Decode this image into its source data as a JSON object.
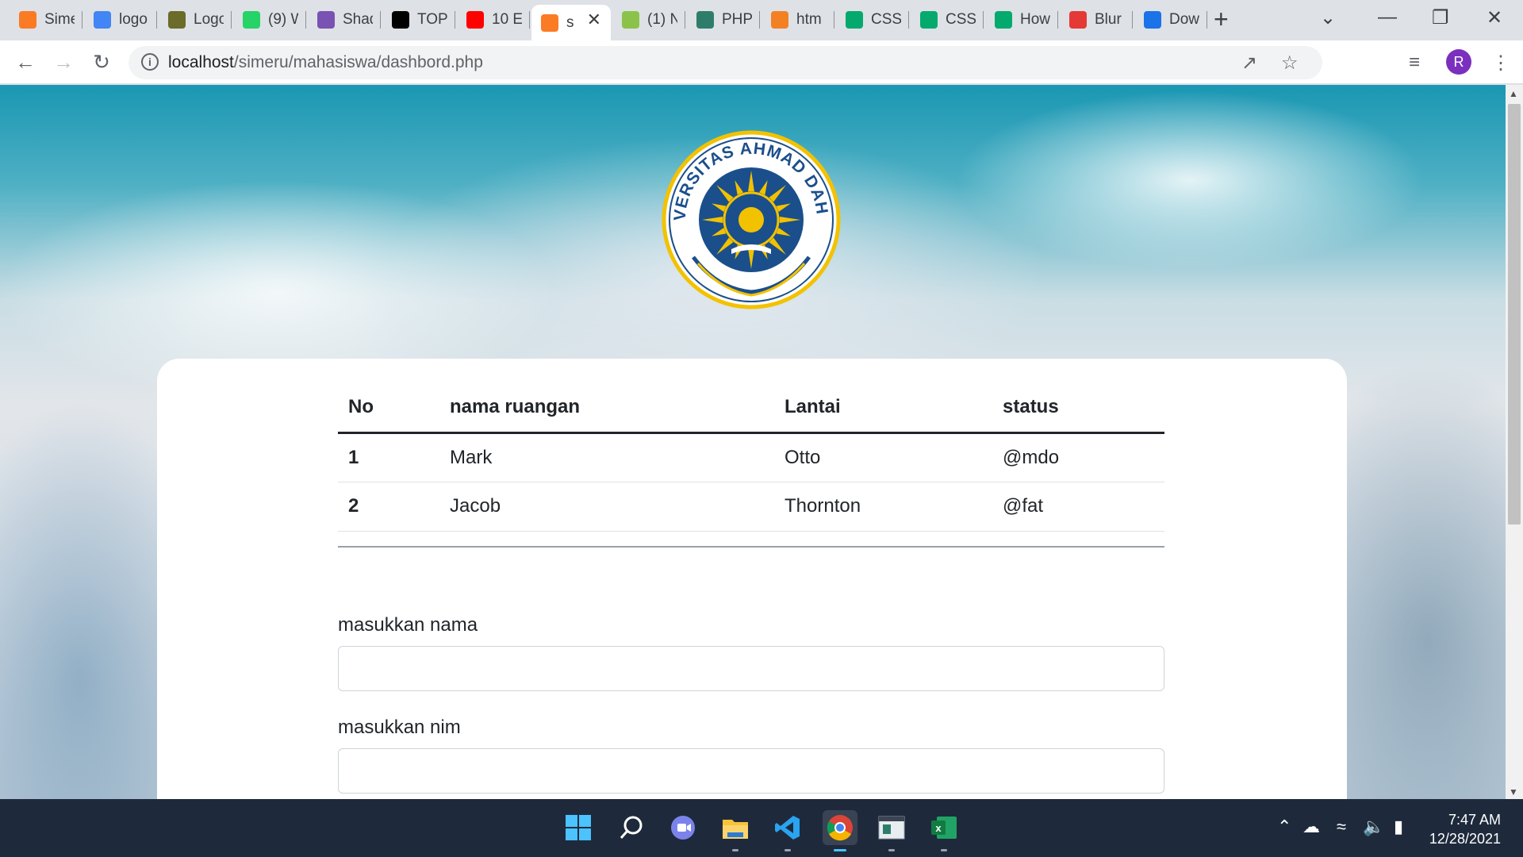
{
  "browser": {
    "tabs": [
      {
        "title": "Sime",
        "favicon": "xampp-icon",
        "color": "#fb7a24"
      },
      {
        "title": "logo",
        "favicon": "google-icon",
        "color": "#4285f4"
      },
      {
        "title": "Logo",
        "favicon": "uad-logo-icon",
        "color": "#6b6b2a"
      },
      {
        "title": "(9) W",
        "favicon": "whatsapp-icon",
        "color": "#25d366"
      },
      {
        "title": "Shad",
        "favicon": "bootstrap-icon",
        "color": "#7952b3"
      },
      {
        "title": "TOP",
        "favicon": "dev-icon",
        "color": "#000000"
      },
      {
        "title": "10 E",
        "favicon": "youtube-icon",
        "color": "#ff0000"
      },
      {
        "title": "s",
        "favicon": "xampp-icon",
        "color": "#fb7a24",
        "active": true
      },
      {
        "title": "(1) N",
        "favicon": "image-icon",
        "color": "#8bc34a"
      },
      {
        "title": "PHP",
        "favicon": "php-icon",
        "color": "#2e7d6b"
      },
      {
        "title": "htm",
        "favicon": "stackoverflow-icon",
        "color": "#f48024"
      },
      {
        "title": "CSS",
        "favicon": "w3schools-icon",
        "color": "#04aa6d"
      },
      {
        "title": "CSS",
        "favicon": "w3schools-icon",
        "color": "#04aa6d"
      },
      {
        "title": "How",
        "favicon": "w3schools-icon",
        "color": "#04aa6d"
      },
      {
        "title": "Blur",
        "favicon": "tree-icon",
        "color": "#e53935"
      },
      {
        "title": "Dow",
        "favicon": "download-icon",
        "color": "#1a73e8"
      }
    ],
    "url_host": "localhost",
    "url_path": "/simeru/mahasiswa/dashbord.php",
    "profile_initial": "R"
  },
  "logo": {
    "text": "UNIVERSITAS AHMAD DAHLAN",
    "colors": {
      "ring": "#f2c200",
      "field": "#1b4f8c"
    }
  },
  "table": {
    "headers": [
      "No",
      "nama ruangan",
      "Lantai",
      "status"
    ],
    "rows": [
      [
        "1",
        "Mark",
        "Otto",
        "@mdo"
      ],
      [
        "2",
        "Jacob",
        "Thornton",
        "@fat"
      ]
    ]
  },
  "form": {
    "nama_label": "masukkan nama",
    "nama_value": "",
    "nim_label": "masukkan nim",
    "nim_value": ""
  },
  "taskbar": {
    "apps": [
      "windows-start-icon",
      "search-icon",
      "teams-chat-icon",
      "file-explorer-icon",
      "vscode-icon",
      "chrome-icon",
      "terminal-icon",
      "excel-icon"
    ],
    "active_app": "chrome-icon",
    "time": "7:47 AM",
    "date": "12/28/2021"
  }
}
